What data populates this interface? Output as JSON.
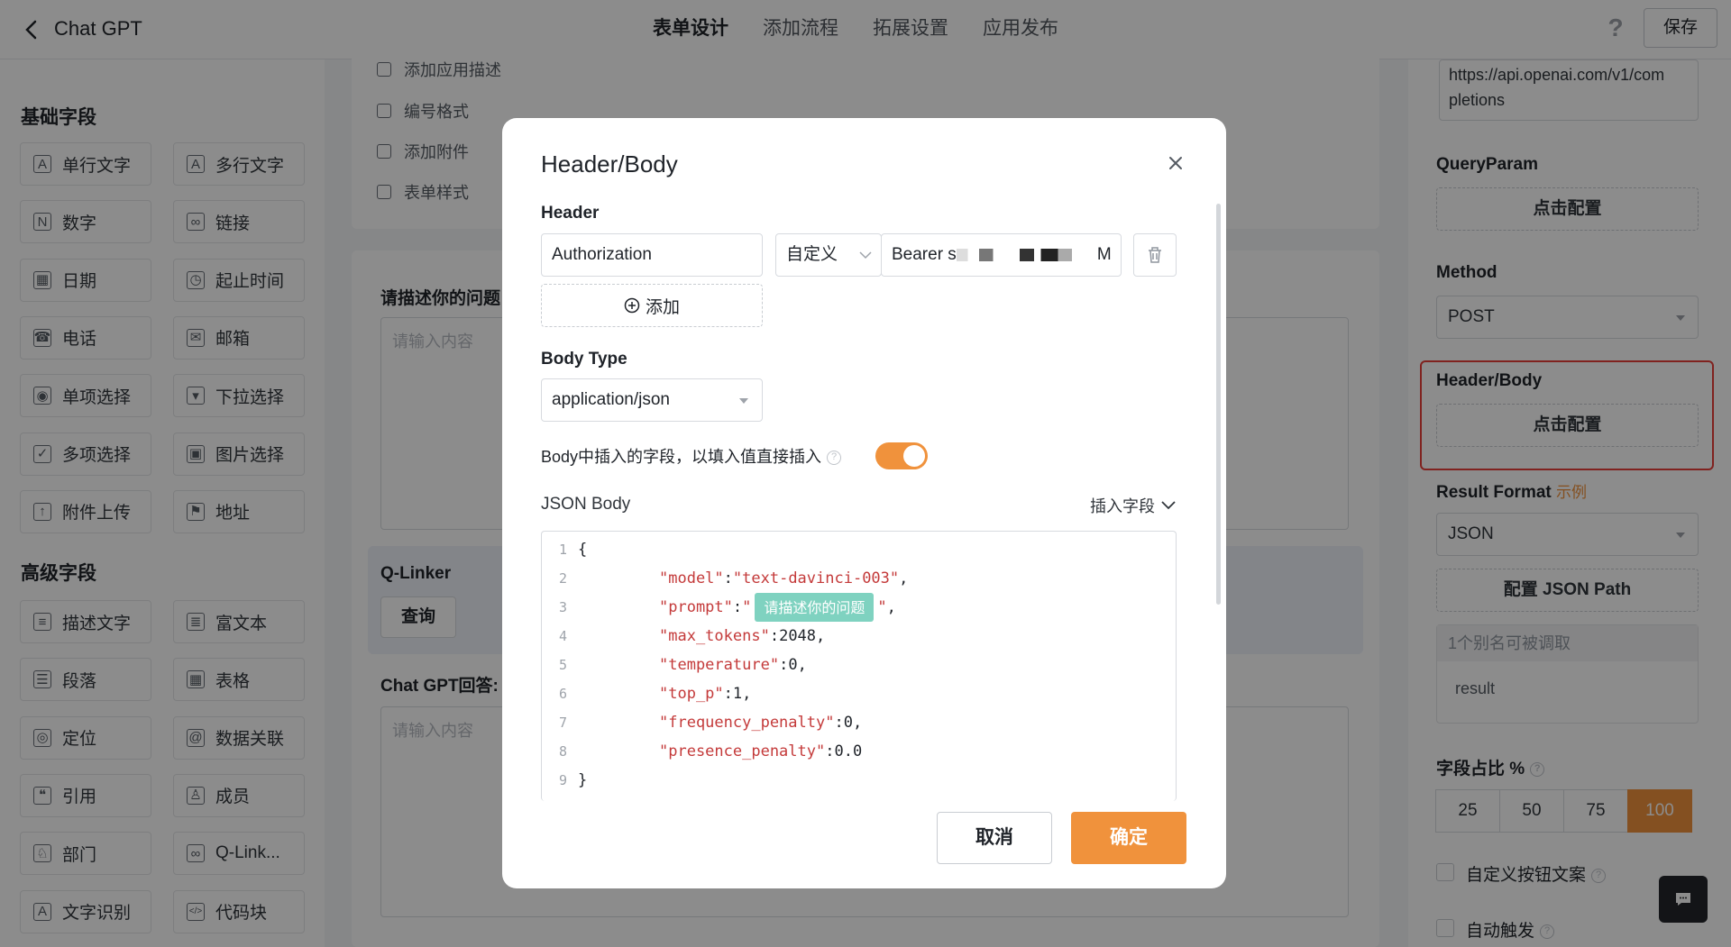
{
  "topbar": {
    "app_title": "Chat GPT",
    "tabs": [
      "表单设计",
      "添加流程",
      "拓展设置",
      "应用发布"
    ],
    "active_tab": 0,
    "help": "?",
    "save_label": "保存"
  },
  "left": {
    "basic_title": "基础字段",
    "basic_fields": [
      {
        "label": "单行文字",
        "icon": "single-line-text-icon",
        "glyph": "A"
      },
      {
        "label": "多行文字",
        "icon": "multi-line-text-icon",
        "glyph": "A"
      },
      {
        "label": "数字",
        "icon": "number-icon",
        "glyph": "N"
      },
      {
        "label": "链接",
        "icon": "link-icon",
        "glyph": "∞"
      },
      {
        "label": "日期",
        "icon": "calendar-icon",
        "glyph": "▦"
      },
      {
        "label": "起止时间",
        "icon": "time-range-icon",
        "glyph": "◷"
      },
      {
        "label": "电话",
        "icon": "phone-icon",
        "glyph": "☎"
      },
      {
        "label": "邮箱",
        "icon": "mail-icon",
        "glyph": "✉"
      },
      {
        "label": "单项选择",
        "icon": "radio-icon",
        "glyph": "◉"
      },
      {
        "label": "下拉选择",
        "icon": "dropdown-icon",
        "glyph": "▾"
      },
      {
        "label": "多项选择",
        "icon": "checkbox-icon",
        "glyph": "✓"
      },
      {
        "label": "图片选择",
        "icon": "image-icon",
        "glyph": "▣"
      },
      {
        "label": "附件上传",
        "icon": "upload-icon",
        "glyph": "↑"
      },
      {
        "label": "地址",
        "icon": "address-icon",
        "glyph": "⚑"
      }
    ],
    "advanced_title": "高级字段",
    "advanced_fields": [
      {
        "label": "描述文字",
        "icon": "description-icon",
        "glyph": "≡"
      },
      {
        "label": "富文本",
        "icon": "rich-text-icon",
        "glyph": "≣"
      },
      {
        "label": "段落",
        "icon": "paragraph-icon",
        "glyph": "☰"
      },
      {
        "label": "表格",
        "icon": "table-icon",
        "glyph": "▦"
      },
      {
        "label": "定位",
        "icon": "location-icon",
        "glyph": "◎"
      },
      {
        "label": "数据关联",
        "icon": "data-link-icon",
        "glyph": "@"
      },
      {
        "label": "引用",
        "icon": "reference-icon",
        "glyph": "❝"
      },
      {
        "label": "成员",
        "icon": "member-icon",
        "glyph": "♙"
      },
      {
        "label": "部门",
        "icon": "department-icon",
        "glyph": "♘"
      },
      {
        "label": "Q-Link...",
        "icon": "qlinker-icon",
        "glyph": "∞"
      },
      {
        "label": "文字识别",
        "icon": "ocr-icon",
        "glyph": "A"
      },
      {
        "label": "代码块",
        "icon": "code-icon",
        "glyph": "</>"
      }
    ]
  },
  "canvas": {
    "menu": [
      {
        "label": "添加应用描述",
        "icon": "description-add-icon"
      },
      {
        "label": "编号格式",
        "icon": "numbering-icon"
      },
      {
        "label": "添加附件",
        "icon": "attachment-icon"
      },
      {
        "label": "表单样式",
        "icon": "style-icon"
      }
    ],
    "question_label": "请描述你的问题",
    "question_placeholder": "请输入内容",
    "qlinker_label": "Q-Linker",
    "query_label": "查询",
    "answer_label": "Chat GPT回答:",
    "answer_placeholder": "请输入内容"
  },
  "right": {
    "url_value": "https://api.openai.com/v1/com\npletions",
    "query_param_label": "QueryParam",
    "query_param_btn": "点击配置",
    "method_label": "Method",
    "method_value": "POST",
    "header_body_label": "Header/Body",
    "header_body_btn": "点击配置",
    "result_format_label": "Result Format",
    "result_format_link": "示例",
    "result_format_value": "JSON",
    "json_path_btn": "配置 JSON Path",
    "alias_hint": "1个别名可被调取",
    "alias_value": "result",
    "ratio_label": "字段占比 %",
    "ratios": [
      "25",
      "50",
      "75",
      "100"
    ],
    "ratio_selected": "100",
    "custom_btn_text_label": "自定义按钮文案",
    "auto_trigger_label": "自动触发"
  },
  "modal": {
    "title": "Header/Body",
    "header_section": "Header",
    "header_key": "Authorization",
    "header_type": "自定义",
    "header_value_prefix": "Bearer s",
    "header_value_suffix": "M",
    "add_label": "添加",
    "body_type_section": "Body Type",
    "body_type_value": "application/json",
    "toggle_label": "Body中插入的字段，以填入值直接插入",
    "toggle_on": true,
    "json_body_section": "JSON Body",
    "insert_field_label": "插入字段",
    "code": {
      "open": "{",
      "close": "}",
      "inserted_field": "请描述你的问题",
      "lines": [
        {
          "key": "\"model\"",
          "value": "\"text-davinci-003\"",
          "type": "string"
        },
        {
          "key": "\"prompt\"",
          "value": "",
          "type": "field"
        },
        {
          "key": "\"max_tokens\"",
          "value": "2048",
          "type": "number"
        },
        {
          "key": "\"temperature\"",
          "value": "0",
          "type": "number"
        },
        {
          "key": "\"top_p\"",
          "value": "1",
          "type": "number"
        },
        {
          "key": "\"frequency_penalty\"",
          "value": "0",
          "type": "number"
        },
        {
          "key": "\"presence_penalty\"",
          "value": "0.0",
          "type": "number"
        }
      ],
      "line_numbers": [
        "1",
        "2",
        "3",
        "4",
        "5",
        "6",
        "7",
        "8",
        "9"
      ]
    },
    "cancel_label": "取消",
    "ok_label": "确定"
  },
  "colors": {
    "accent": "#f0923c",
    "highlight_border": "#ea3f3a",
    "field_tag": "#7fd2c0",
    "json_key": "#c43a3a"
  }
}
